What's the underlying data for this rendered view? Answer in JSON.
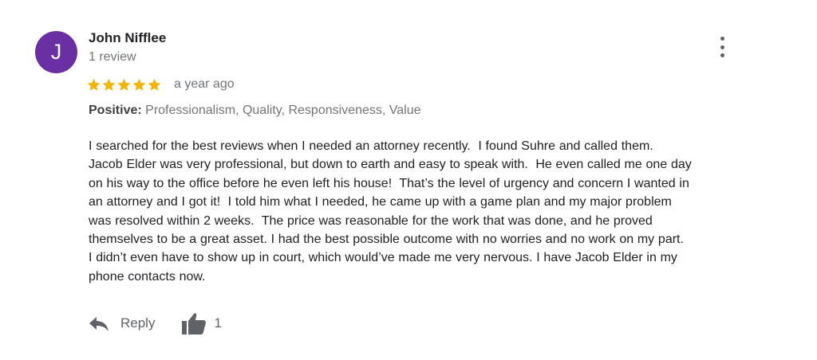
{
  "review": {
    "author": {
      "initial": "J",
      "name": "John Nifflee",
      "review_count": "1 review",
      "avatar_color": "#6a2fa3"
    },
    "rating": 5,
    "max_rating": 5,
    "star_color": "#f4b400",
    "time_ago": "a year ago",
    "tags_label": "Positive:",
    "tags_values": "Professionalism, Quality, Responsiveness, Value",
    "text_lines": [
      "I searched for the best reviews when I needed an attorney recently.  I found Suhre and called them.",
      "Jacob Elder was very professional, but down to earth and easy to speak with.  He even called me one day",
      "on his way to the office before he even left his house!  That’s the level of urgency and concern I wanted in",
      "an attorney and I got it!  I told him what I needed, he came up with a game plan and my major problem",
      "was resolved within 2 weeks.  The price was reasonable for the work that was done, and he proved",
      "themselves to be a great asset. I had the best possible outcome with no worries and no work on my part.",
      "I didn’t even have to show up in court, which would’ve made me very nervous. I have Jacob Elder in my",
      "phone contacts now."
    ],
    "actions": {
      "reply_label": "Reply",
      "reply_icon": "reply-arrow-icon",
      "like_icon": "thumbs-up-icon",
      "like_count": "1"
    },
    "menu_icon": "more-vertical-icon"
  }
}
